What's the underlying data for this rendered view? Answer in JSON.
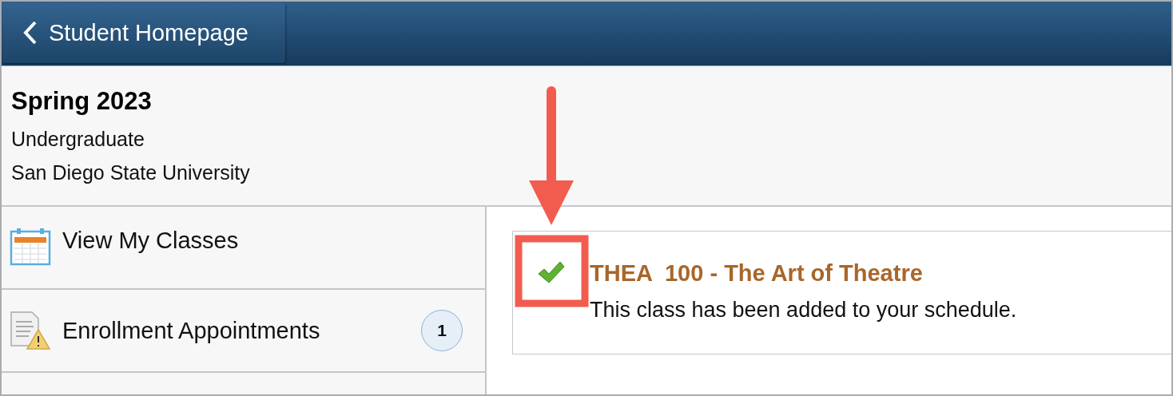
{
  "header": {
    "back_button": "Student Homepage"
  },
  "term": {
    "title": "Spring 2023",
    "career": "Undergraduate",
    "institution": "San Diego State University"
  },
  "nav": [
    {
      "kind": "calendar",
      "label": "View My Classes"
    },
    {
      "kind": "appointment",
      "label": "Enrollment Appointments",
      "badge": "1"
    }
  ],
  "message": {
    "kind": "success",
    "title": "THEA  100 - The Art of Theatre",
    "text": "This class has been added to your schedule."
  }
}
